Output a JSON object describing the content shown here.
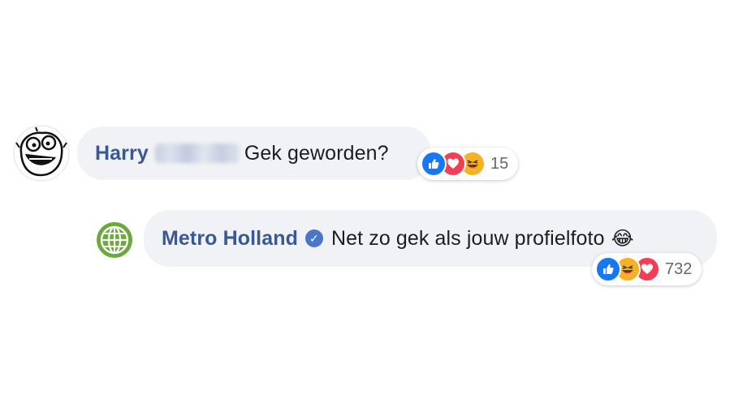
{
  "comments": [
    {
      "author_first": "Harry",
      "text": "Gek geworden?",
      "reaction_count": "15",
      "reactions": [
        "like-icon",
        "love-icon",
        "haha-icon"
      ]
    },
    {
      "author": "Metro Holland",
      "verified_mark": "✓",
      "text": "Net zo gek als jouw profielfoto",
      "emoji": "😂",
      "reaction_count": "732",
      "reactions": [
        "like-icon",
        "haha-icon",
        "love-icon"
      ]
    }
  ],
  "colors": {
    "author": "#385898",
    "bubble": "#f0f2f5",
    "like": "#1877f2",
    "love": "#f33e58",
    "haha": "#f7b125",
    "globe": "#6aaa3a"
  }
}
